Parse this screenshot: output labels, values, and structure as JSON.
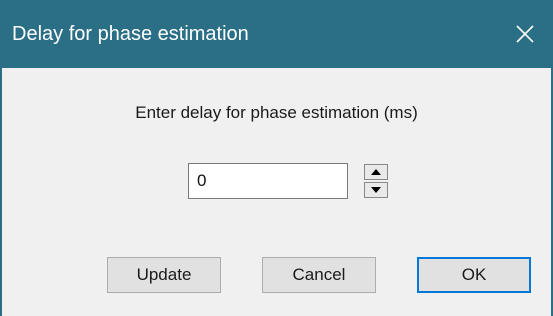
{
  "window": {
    "title": "Delay for phase estimation",
    "close_icon": "close-icon"
  },
  "dialog": {
    "prompt": "Enter delay for phase estimation (ms)",
    "delay_value": "0",
    "spinner_up_icon": "chevron-up-icon",
    "spinner_down_icon": "chevron-down-icon"
  },
  "buttons": {
    "update_label": "Update",
    "cancel_label": "Cancel",
    "ok_label": "OK"
  },
  "colors": {
    "titlebar": "#2a6f85",
    "dialog_background": "#f0f0f0",
    "default_button_border": "#0078d7"
  }
}
